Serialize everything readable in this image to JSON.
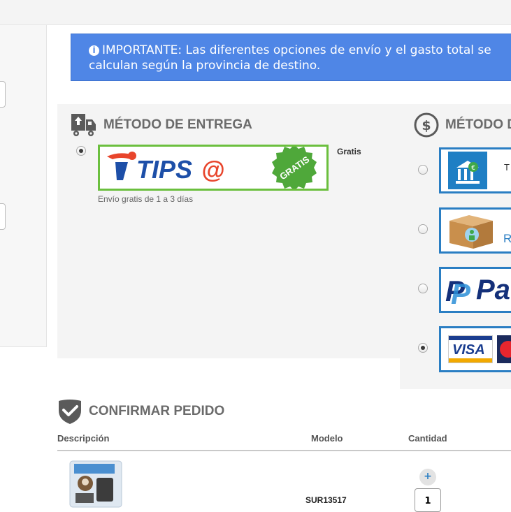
{
  "notice": {
    "icon": "info-icon",
    "text": "IMPORTANTE: Las diferentes opciones de envío y el gasto total se calculan según la provincia de destino."
  },
  "delivery": {
    "title": "MÉTODO DE ENTREGA",
    "icon": "delivery-truck-icon",
    "option": {
      "brand": "TIPS@",
      "badge": "GRATIS",
      "price": "Gratis",
      "note": "Envío gratis de 1 a 3 días",
      "selected": true
    }
  },
  "payment": {
    "title": "MÉTODO D",
    "icon": "dollar-circle-icon",
    "options": [
      {
        "name": "bank-transfer",
        "label": "T",
        "selected": false
      },
      {
        "name": "cash-on-delivery",
        "label": "R",
        "selected": false
      },
      {
        "name": "paypal",
        "label": "Pa",
        "selected": false
      },
      {
        "name": "credit-card",
        "label": "VISA",
        "selected": true
      }
    ]
  },
  "confirm": {
    "title": "CONFIRMAR PEDIDO",
    "icon": "shield-check-icon",
    "columns": {
      "description": "Descripción",
      "model": "Modelo",
      "quantity": "Cantidad"
    },
    "rows": [
      {
        "model": "SUR13517",
        "quantity": "1"
      }
    ]
  },
  "colors": {
    "accent": "#2a7ec3",
    "notice_bg": "#4f86e6",
    "tips_green": "#6bbf3e",
    "tips_red": "#e8452c",
    "tips_blue": "#1d4fa8"
  }
}
